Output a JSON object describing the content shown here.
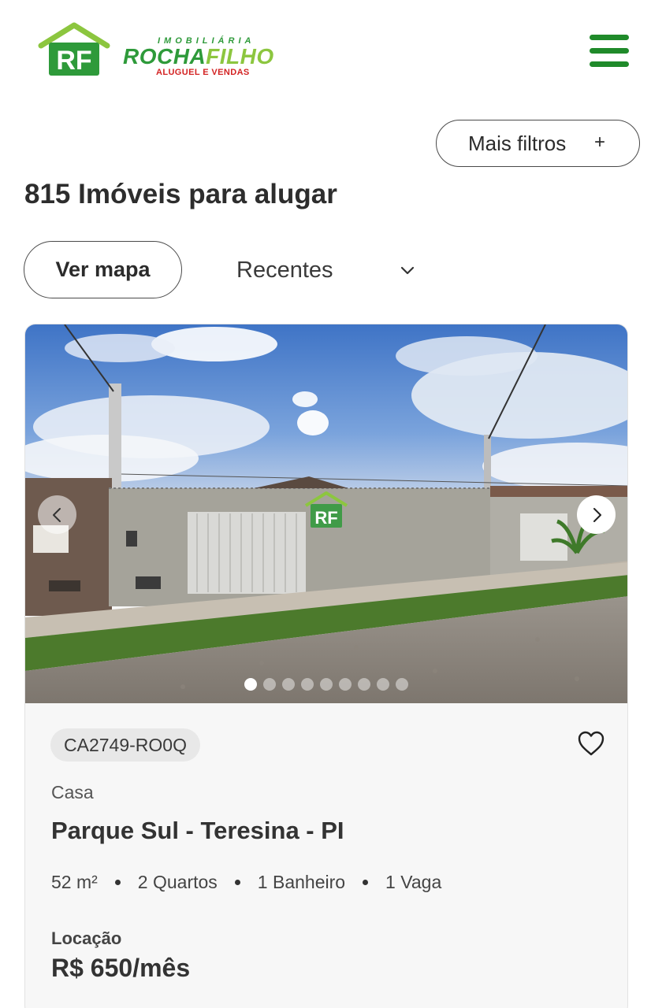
{
  "header": {
    "logo": {
      "badge_text": "RF",
      "small_text": "IMOBILIÁRIA",
      "main_part1": "ROCHA",
      "main_part2": "FILHO",
      "sub_text": "ALUGUEL E VENDAS",
      "colors": {
        "green": "#2e9a3a",
        "light_green": "#8cc63f",
        "red": "#d32323"
      }
    },
    "menu_icon": "hamburger-menu-icon",
    "menu_color": "#1f8a2a"
  },
  "toolbar": {
    "more_filters_label": "Mais filtros",
    "more_filters_icon": "+",
    "results_title": "815 Imóveis para alugar",
    "map_button_label": "Ver mapa",
    "sort_selected": "Recentes"
  },
  "listing": {
    "photo": {
      "watermark": "RF",
      "slides_total": 9,
      "active_slide": 1
    },
    "code": "CA2749-RO0Q",
    "type": "Casa",
    "location": "Parque Sul - Teresina - PI",
    "features": {
      "area": "52 m²",
      "bedrooms": "2 Quartos",
      "bathrooms": "1 Banheiro",
      "parking": "1 Vaga"
    },
    "price_label": "Locação",
    "price": "R$ 650/mês"
  }
}
